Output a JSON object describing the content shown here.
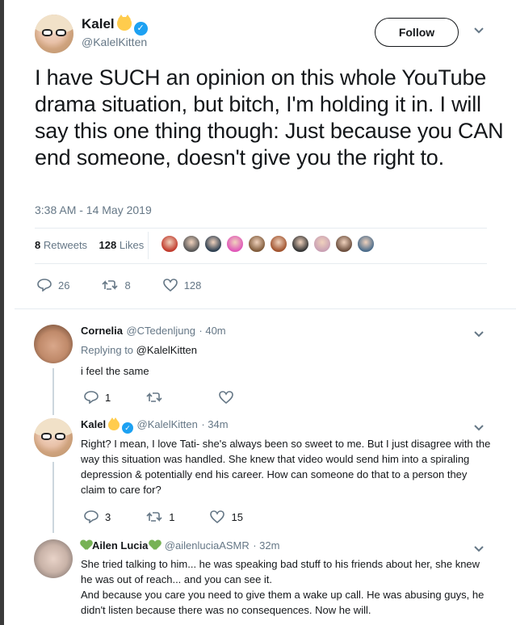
{
  "main_tweet": {
    "name": "Kalel",
    "handle": "@KalelKitten",
    "follow_label": "Follow",
    "text": "I have SUCH an opinion on this whole YouTube drama situation, but bitch, I'm holding it in. I will say this one thing though: Just because you CAN end someone, doesn't give you the right to.",
    "timestamp": "3:38 AM - 14 May 2019",
    "retweets_count": "8",
    "retweets_label": "Retweets",
    "likes_count": "128",
    "likes_label": "Likes",
    "reply_count": "26",
    "retweet_count": "8",
    "like_count": "128"
  },
  "replies": [
    {
      "name": "Cornelia",
      "handle": "@CTedenljung",
      "time": "· 40m",
      "replying_prefix": "Replying to",
      "replying_to": "@KalelKitten",
      "text": "i feel the same",
      "reply_count": "1",
      "retweet_count": "",
      "like_count": ""
    },
    {
      "name": "Kalel",
      "handle": "@KalelKitten",
      "time": "· 34m",
      "text": "Right? I mean, I love Tati- she's always been so sweet to me. But I just disagree with the way this situation was handled. She knew that video would send him into a spiraling depression & potentially end his career. How can someone do that to a person they claim to care for?",
      "reply_count": "3",
      "retweet_count": "1",
      "like_count": "15"
    },
    {
      "name": "Ailen Lucia",
      "handle": "@ailenluciaASMR",
      "time": "· 32m",
      "text": "She tried talking to him... he was speaking bad stuff to his friends about her, she knew he was out of reach... and you can see it.\nAnd because you care you need to give them a wake up call. He was abusing guys, he didn't listen because there was no consequences. Now he will."
    }
  ],
  "colors": {
    "accent": "#1da1f2",
    "secondary_text": "#657786",
    "divider": "#e6ecf0",
    "green_heart": "#77b255"
  },
  "liker_colors": [
    "#c0392b",
    "#555555",
    "#2c3e50",
    "#e056b8",
    "#7f5a3a",
    "#a0522d",
    "#333333",
    "#c9a0b4",
    "#6b4e3d",
    "#4a6b8a"
  ]
}
